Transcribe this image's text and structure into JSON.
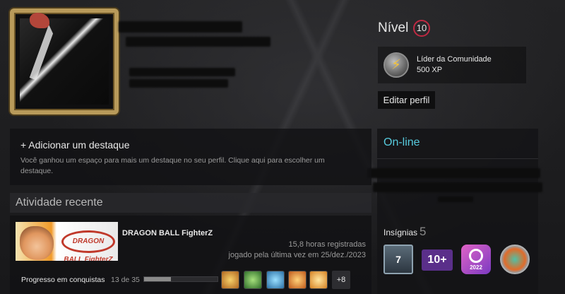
{
  "level": {
    "label": "Nível",
    "value": "10"
  },
  "featured_badge": {
    "name": "Líder da Comunidade",
    "xp": "500 XP",
    "icon": "community-leader-badge-icon"
  },
  "edit_profile_label": "Editar perfil",
  "status": {
    "text": "On-line",
    "color": "#57cbde"
  },
  "badges": {
    "label": "Insígnias",
    "count": "5",
    "items": [
      "years-of-service-7",
      "level-10-plus",
      "steam-replay-2022",
      "fire-badge"
    ],
    "years_label": "7",
    "level_label": "10+",
    "replay_year": "2022"
  },
  "highlight": {
    "title": "+ Adicionar um destaque",
    "description": "Você ganhou um espaço para mais um destaque no seu perfil. Clique aqui para escolher um destaque."
  },
  "activity": {
    "title": "Atividade recente",
    "game": {
      "name": "DRAGON BALL FighterZ",
      "cap_logo": "DRAGON BALL FighterZ",
      "hours": "15,8 horas registradas",
      "last_played": "jogado pela última vez em 25/dez./2023",
      "achievements_label": "Progresso em conquistas",
      "achievements_count": "13 de 35",
      "achievements_progress": 0.37,
      "more_label": "+8"
    }
  },
  "colors": {
    "level_ring": "#c02942",
    "accent": "#57cbde"
  }
}
